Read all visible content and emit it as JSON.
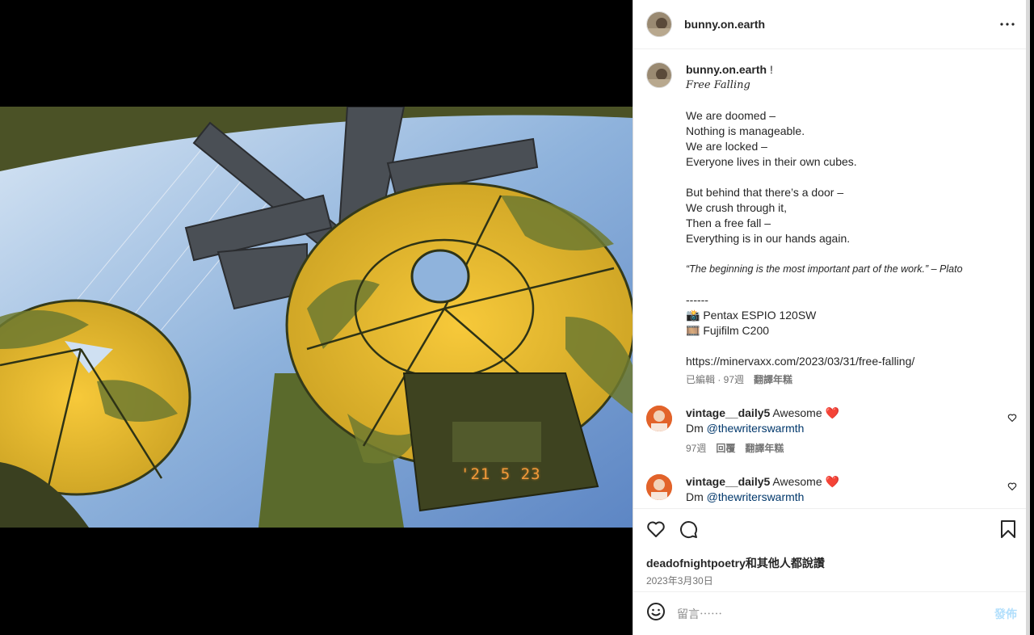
{
  "post": {
    "username": "bunny.on.earth",
    "date_stamp": "'21 5 23"
  },
  "caption": {
    "username": "bunny.on.earth",
    "suffix": "!",
    "title": "Free Falling",
    "lines_1": [
      "We are doomed –",
      "Nothing is manageable.",
      "We are locked –",
      "Everyone lives in their own cubes."
    ],
    "lines_2": [
      "But behind that there’s a door –",
      "We crush through it,",
      "Then a free fall –",
      "Everything is in our hands again."
    ],
    "quote": "“The beginning is the most important part of the work.” – Plato",
    "divider": "------",
    "camera": "📸 Pentax ESPIO 120SW",
    "film": "🎞️ Fujifilm C200",
    "link": "https://minervaxx.com/2023/03/31/free-falling/",
    "meta_edited": "已編輯 · 97週",
    "meta_translate": "翻譯年糕"
  },
  "comments": [
    {
      "username": "vintage__daily5",
      "text": "Awesome",
      "emoji": "❤️",
      "line2_prefix": "Dm ",
      "mention": "@thewriterswarmth",
      "age": "97週",
      "reply": "回覆",
      "translate": "翻譯年糕"
    },
    {
      "username": "vintage__daily5",
      "text": "Awesome",
      "emoji": "❤️",
      "line2_prefix": "Dm ",
      "mention": "@thewriterswarmth"
    }
  ],
  "actions": {
    "likes_text": "deadofnightpoetry和其他人都說讚",
    "date": "2023年3月30日"
  },
  "add_comment": {
    "placeholder": "留言⋯⋯",
    "post_label": "發佈"
  },
  "icons": [
    "more-icon",
    "heart-icon",
    "comment-icon",
    "bookmark-icon",
    "emoji-icon",
    "like-comment-icon"
  ],
  "colors": {
    "link": "#00376b",
    "post_disabled": "#b2dffc",
    "meta": "#737373"
  }
}
